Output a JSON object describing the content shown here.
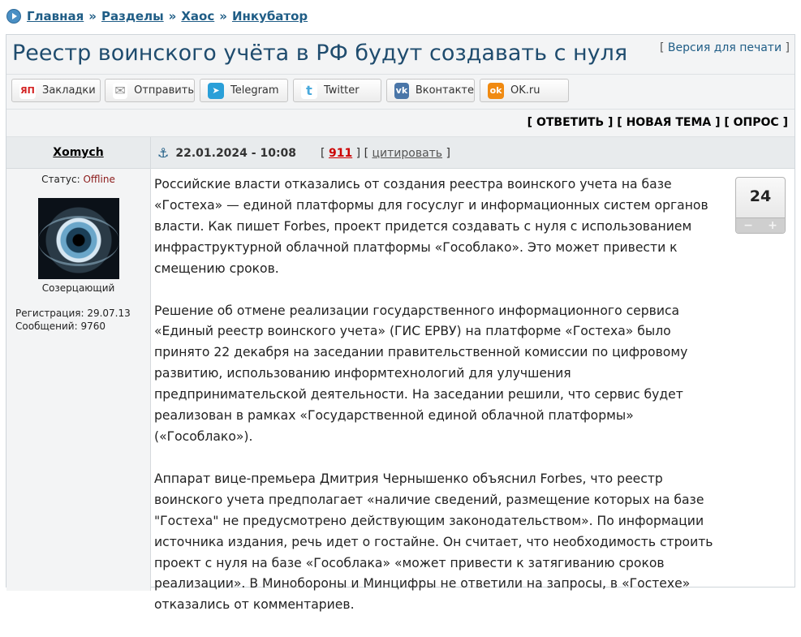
{
  "breadcrumb": {
    "items": [
      "Главная",
      "Разделы",
      "Хаос",
      "Инкубатор"
    ],
    "separator": "»"
  },
  "topic": {
    "title": "Реестр воинского учёта в РФ будут создавать с нуля",
    "print_link": "Версия для печати"
  },
  "share": [
    {
      "label": "Закладки",
      "icon": "yandex-bookmarks-icon",
      "icon_text": "ЯП",
      "color": "#d32020"
    },
    {
      "label": "Отправить",
      "icon": "mail-icon",
      "icon_text": "✉",
      "color": "#8c8c8c"
    },
    {
      "label": "Telegram",
      "icon": "telegram-icon",
      "icon_text": "➤",
      "color": "#2a9fd8"
    },
    {
      "label": "Twitter",
      "icon": "twitter-icon",
      "icon_text": "t",
      "color": "#49a9dc"
    },
    {
      "label": "Вконтакте",
      "icon": "vk-icon",
      "icon_text": "vk",
      "color": "#4a76a8"
    },
    {
      "label": "OK.ru",
      "icon": "ok-icon",
      "icon_text": "ok",
      "color": "#f08a11"
    }
  ],
  "actions": {
    "reply": "ОТВЕТИТЬ",
    "new_topic": "НОВАЯ ТЕМА",
    "poll": "ОПРОС"
  },
  "post": {
    "author": "Xomych",
    "date": "22.01.2024 - 10:08",
    "number": "911",
    "cite": "цитировать",
    "status_label": "Статус:",
    "status_value": "Offline",
    "rank": "Созерцающий",
    "registration": "Регистрация: 29.07.13",
    "messages": "Сообщений: 9760",
    "rating": "24",
    "paragraphs": [
      "Российские власти отказались от создания реестра воинского учета на базе «Гостеха» — единой платформы для госуслуг и информационных систем органов власти. Как пишет Forbes, проект придется создавать с нуля с использованием инфраструктурной облачной платформы «Гособлако». Это может привести к смещению сроков.",
      "Решение об отмене реализации государственного информационного сервиса «Единый реестр воинского учета» (ГИС ЕРВУ) на платформе «Гостеха» было принято 22 декабря на заседании правительственной комиссии по цифровому развитию, использованию информтехнологий для улучшения предпринимательской деятельности. На заседании решили, что сервис будет реализован в рамках «Государственной единой облачной платформы» («Гособлако»).",
      "Аппарат вице-премьера Дмитрия Чернышенко объяснил Forbes, что реестр воинского учета предполагает «наличие сведений, размещение которых на базе \"Гостеха\" не предусмотрено действующим законодательством». По информации источника издания, речь идет о гостайне. Он считает, что необходимость строить проект с нуля на базе «Гособлака» «может привести к затягиванию сроков реализации». В Минобороны и Минцифры не ответили на запросы, в «Гостехе» отказались от комментариев."
    ]
  }
}
